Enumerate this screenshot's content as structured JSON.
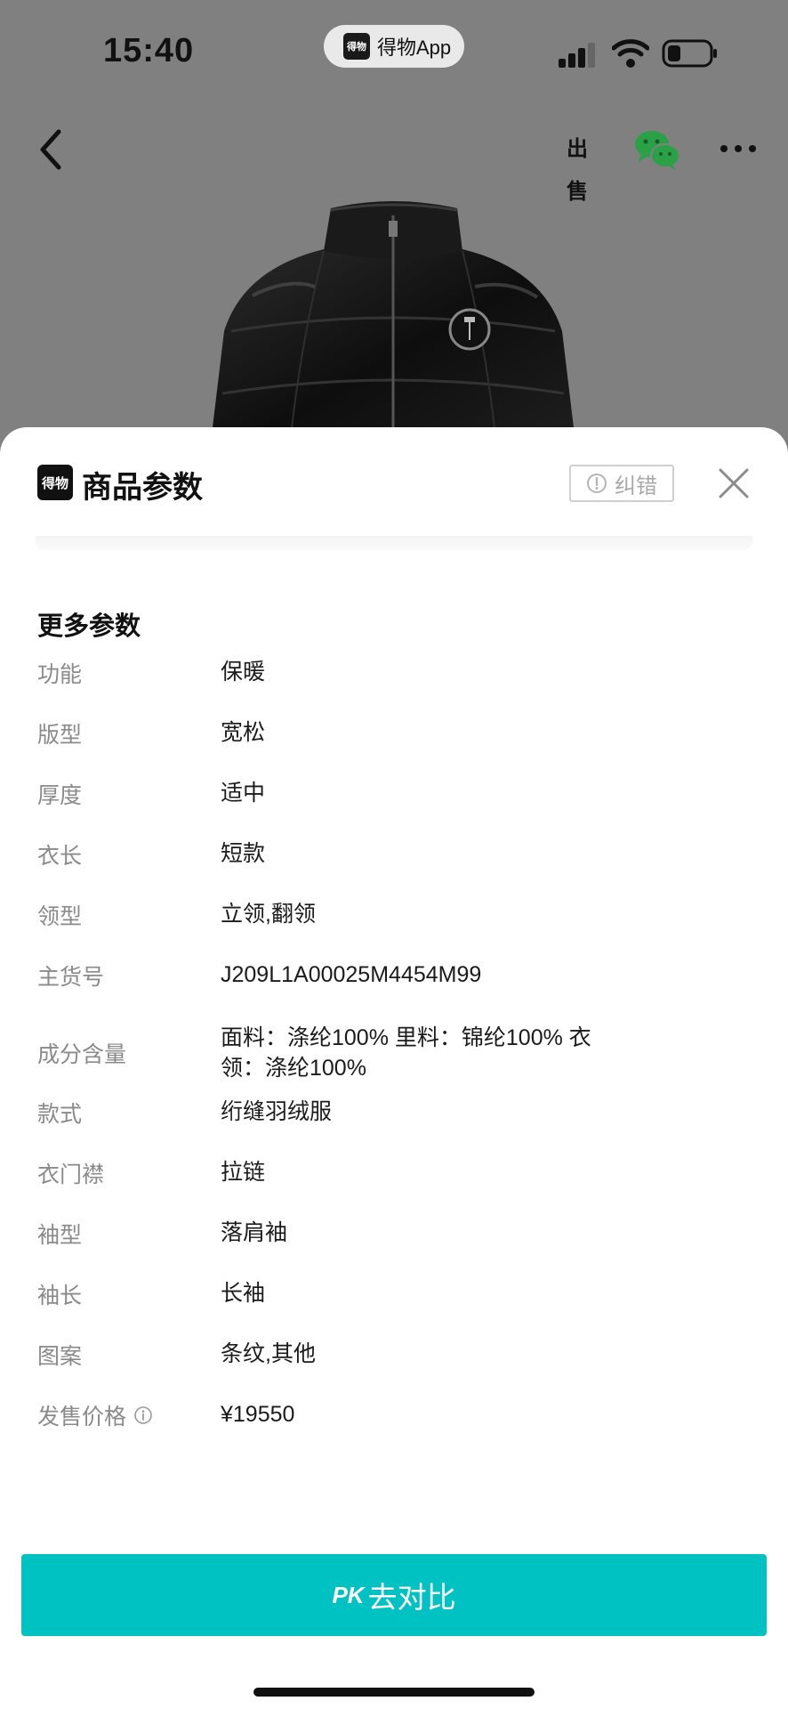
{
  "status_bar": {
    "time": "15:40",
    "app_pill_logo": "得物",
    "app_pill_name": "得物App"
  },
  "nav": {
    "sell_label": "出售",
    "icons": [
      "back-icon",
      "sell-icon",
      "wechat-icon",
      "more-icon"
    ]
  },
  "sheet": {
    "brand_badge": "得物",
    "title": "商品参数",
    "correct_label": "纠错",
    "section_title": "更多参数",
    "params": [
      {
        "label": "功能",
        "value": "保暖"
      },
      {
        "label": "版型",
        "value": "宽松"
      },
      {
        "label": "厚度",
        "value": "适中"
      },
      {
        "label": "衣长",
        "value": "短款"
      },
      {
        "label": "领型",
        "value": "立领,翻领"
      },
      {
        "label": "主货号",
        "value": "J209L1A00025M4454M99"
      },
      {
        "label": "成分含量",
        "value": "面料：涤纶100% 里料：锦纶100% 衣领：涤纶100%"
      },
      {
        "label": "款式",
        "value": "绗缝羽绒服"
      },
      {
        "label": "衣门襟",
        "value": "拉链"
      },
      {
        "label": "袖型",
        "value": "落肩袖"
      },
      {
        "label": "袖长",
        "value": "长袖"
      },
      {
        "label": "图案",
        "value": "条纹,其他"
      },
      {
        "label": "发售价格",
        "value": "¥19550"
      }
    ]
  },
  "footer": {
    "pk_prefix": "PK",
    "pk_label": "去对比"
  },
  "colors": {
    "accent": "#01c2c3",
    "backdrop": "#808080",
    "label_grey": "#8a8a8a",
    "wechat_green": "#2aa146"
  }
}
